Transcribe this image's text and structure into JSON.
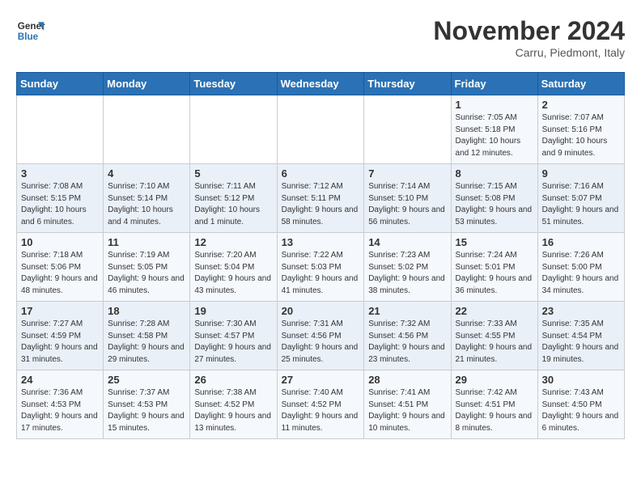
{
  "logo": {
    "line1": "General",
    "line2": "Blue"
  },
  "title": "November 2024",
  "location": "Carru, Piedmont, Italy",
  "weekdays": [
    "Sunday",
    "Monday",
    "Tuesday",
    "Wednesday",
    "Thursday",
    "Friday",
    "Saturday"
  ],
  "weeks": [
    [
      {
        "day": "",
        "info": ""
      },
      {
        "day": "",
        "info": ""
      },
      {
        "day": "",
        "info": ""
      },
      {
        "day": "",
        "info": ""
      },
      {
        "day": "",
        "info": ""
      },
      {
        "day": "1",
        "info": "Sunrise: 7:05 AM\nSunset: 5:18 PM\nDaylight: 10 hours and 12 minutes."
      },
      {
        "day": "2",
        "info": "Sunrise: 7:07 AM\nSunset: 5:16 PM\nDaylight: 10 hours and 9 minutes."
      }
    ],
    [
      {
        "day": "3",
        "info": "Sunrise: 7:08 AM\nSunset: 5:15 PM\nDaylight: 10 hours and 6 minutes."
      },
      {
        "day": "4",
        "info": "Sunrise: 7:10 AM\nSunset: 5:14 PM\nDaylight: 10 hours and 4 minutes."
      },
      {
        "day": "5",
        "info": "Sunrise: 7:11 AM\nSunset: 5:12 PM\nDaylight: 10 hours and 1 minute."
      },
      {
        "day": "6",
        "info": "Sunrise: 7:12 AM\nSunset: 5:11 PM\nDaylight: 9 hours and 58 minutes."
      },
      {
        "day": "7",
        "info": "Sunrise: 7:14 AM\nSunset: 5:10 PM\nDaylight: 9 hours and 56 minutes."
      },
      {
        "day": "8",
        "info": "Sunrise: 7:15 AM\nSunset: 5:08 PM\nDaylight: 9 hours and 53 minutes."
      },
      {
        "day": "9",
        "info": "Sunrise: 7:16 AM\nSunset: 5:07 PM\nDaylight: 9 hours and 51 minutes."
      }
    ],
    [
      {
        "day": "10",
        "info": "Sunrise: 7:18 AM\nSunset: 5:06 PM\nDaylight: 9 hours and 48 minutes."
      },
      {
        "day": "11",
        "info": "Sunrise: 7:19 AM\nSunset: 5:05 PM\nDaylight: 9 hours and 46 minutes."
      },
      {
        "day": "12",
        "info": "Sunrise: 7:20 AM\nSunset: 5:04 PM\nDaylight: 9 hours and 43 minutes."
      },
      {
        "day": "13",
        "info": "Sunrise: 7:22 AM\nSunset: 5:03 PM\nDaylight: 9 hours and 41 minutes."
      },
      {
        "day": "14",
        "info": "Sunrise: 7:23 AM\nSunset: 5:02 PM\nDaylight: 9 hours and 38 minutes."
      },
      {
        "day": "15",
        "info": "Sunrise: 7:24 AM\nSunset: 5:01 PM\nDaylight: 9 hours and 36 minutes."
      },
      {
        "day": "16",
        "info": "Sunrise: 7:26 AM\nSunset: 5:00 PM\nDaylight: 9 hours and 34 minutes."
      }
    ],
    [
      {
        "day": "17",
        "info": "Sunrise: 7:27 AM\nSunset: 4:59 PM\nDaylight: 9 hours and 31 minutes."
      },
      {
        "day": "18",
        "info": "Sunrise: 7:28 AM\nSunset: 4:58 PM\nDaylight: 9 hours and 29 minutes."
      },
      {
        "day": "19",
        "info": "Sunrise: 7:30 AM\nSunset: 4:57 PM\nDaylight: 9 hours and 27 minutes."
      },
      {
        "day": "20",
        "info": "Sunrise: 7:31 AM\nSunset: 4:56 PM\nDaylight: 9 hours and 25 minutes."
      },
      {
        "day": "21",
        "info": "Sunrise: 7:32 AM\nSunset: 4:56 PM\nDaylight: 9 hours and 23 minutes."
      },
      {
        "day": "22",
        "info": "Sunrise: 7:33 AM\nSunset: 4:55 PM\nDaylight: 9 hours and 21 minutes."
      },
      {
        "day": "23",
        "info": "Sunrise: 7:35 AM\nSunset: 4:54 PM\nDaylight: 9 hours and 19 minutes."
      }
    ],
    [
      {
        "day": "24",
        "info": "Sunrise: 7:36 AM\nSunset: 4:53 PM\nDaylight: 9 hours and 17 minutes."
      },
      {
        "day": "25",
        "info": "Sunrise: 7:37 AM\nSunset: 4:53 PM\nDaylight: 9 hours and 15 minutes."
      },
      {
        "day": "26",
        "info": "Sunrise: 7:38 AM\nSunset: 4:52 PM\nDaylight: 9 hours and 13 minutes."
      },
      {
        "day": "27",
        "info": "Sunrise: 7:40 AM\nSunset: 4:52 PM\nDaylight: 9 hours and 11 minutes."
      },
      {
        "day": "28",
        "info": "Sunrise: 7:41 AM\nSunset: 4:51 PM\nDaylight: 9 hours and 10 minutes."
      },
      {
        "day": "29",
        "info": "Sunrise: 7:42 AM\nSunset: 4:51 PM\nDaylight: 9 hours and 8 minutes."
      },
      {
        "day": "30",
        "info": "Sunrise: 7:43 AM\nSunset: 4:50 PM\nDaylight: 9 hours and 6 minutes."
      }
    ]
  ]
}
